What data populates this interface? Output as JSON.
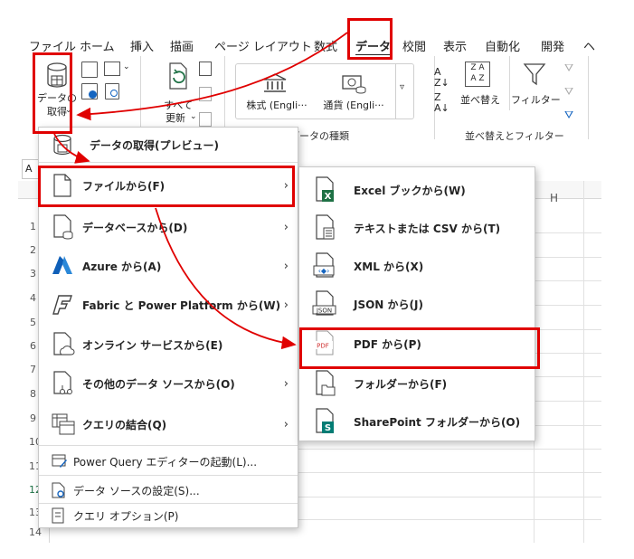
{
  "colors": {
    "highlight": "#e00000",
    "excel_green": "#1e7145",
    "azure_blue": "#0f5fb8",
    "sharepoint_teal": "#037c74"
  },
  "ribbon": {
    "tabs": [
      "ファイル",
      "ホーム",
      "挿入",
      "描画",
      "ページ レイアウト",
      "数式",
      "データ",
      "校閲",
      "表示",
      "自動化",
      "開発",
      "ヘ"
    ],
    "get_data_line1": "データの",
    "get_data_line2": "取得",
    "refresh_line1": "すべて",
    "refresh_line2": "更新",
    "stocks": "株式 (Engli···",
    "currency": "通貨 (Engli···",
    "data_types_group": "データの種類",
    "sort": "並べ替え",
    "filter": "フィルター",
    "sort_filter_group": "並べ替えとフィルター"
  },
  "sheet": {
    "column_h": "H",
    "rows": [
      "1",
      "2",
      "3",
      "4",
      "5",
      "6",
      "7",
      "8",
      "9",
      "10",
      "11",
      "12",
      "13",
      "14"
    ],
    "name_box": "A"
  },
  "menu_main": {
    "items": [
      {
        "label": "データの取得(プレビュー)"
      },
      {
        "label": "ファイルから(F)"
      },
      {
        "label": "データベースから(D)"
      },
      {
        "label": "Azure から(A)"
      },
      {
        "label": "Fabric と Power Platform から(W)"
      },
      {
        "label": "オンライン サービスから(E)"
      },
      {
        "label": "その他のデータ ソースから(O)"
      },
      {
        "label": "クエリの結合(Q)"
      },
      {
        "label": "Power Query エディターの起動(L)..."
      },
      {
        "label": "データ ソースの設定(S)..."
      },
      {
        "label": "クエリ オプション(P)"
      }
    ]
  },
  "menu_sub": {
    "items": [
      {
        "label": "Excel ブックから(W)",
        "icon_text": "X"
      },
      {
        "label": "テキストまたは CSV から(T)"
      },
      {
        "label": "XML から(X)"
      },
      {
        "label": "JSON から(J)",
        "icon_text": "JSON"
      },
      {
        "label": "PDF から(P)",
        "icon_text": "PDF"
      },
      {
        "label": "フォルダーから(F)"
      },
      {
        "label": "SharePoint フォルダーから(O)",
        "icon_text": "S"
      }
    ]
  }
}
